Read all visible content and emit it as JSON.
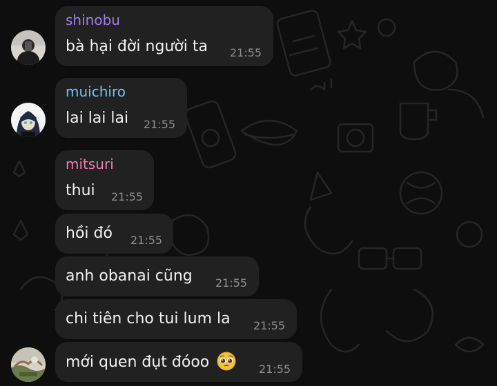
{
  "colors": {
    "background": "#0e0e0e",
    "bubble": "#212121",
    "text": "#f2f2f2",
    "timestamp": "#8e8e8e",
    "shinobu": "#a37bf2",
    "muichiro": "#6ec6f5",
    "mitsuri": "#f27bb4"
  },
  "messages": [
    {
      "sender": "shinobu",
      "text": "bà hại đời người ta",
      "time": "21:55",
      "avatar": "avatar-shinobu"
    },
    {
      "sender": "muichiro",
      "text": "lai lai lai",
      "time": "21:55",
      "avatar": "avatar-muichiro"
    },
    {
      "sender": "mitsuri",
      "text": "thui",
      "time": "21:55"
    },
    {
      "text": "hồi đó",
      "time": "21:55"
    },
    {
      "text": "anh obanai cũng",
      "time": "21:55"
    },
    {
      "text": "chi tiên cho tui lum la",
      "time": "21:55"
    },
    {
      "text": "mới quen đụt đóoo",
      "time": "21:55",
      "emoji": "pleading-face-icon",
      "avatar": "avatar-mitsuri"
    }
  ]
}
